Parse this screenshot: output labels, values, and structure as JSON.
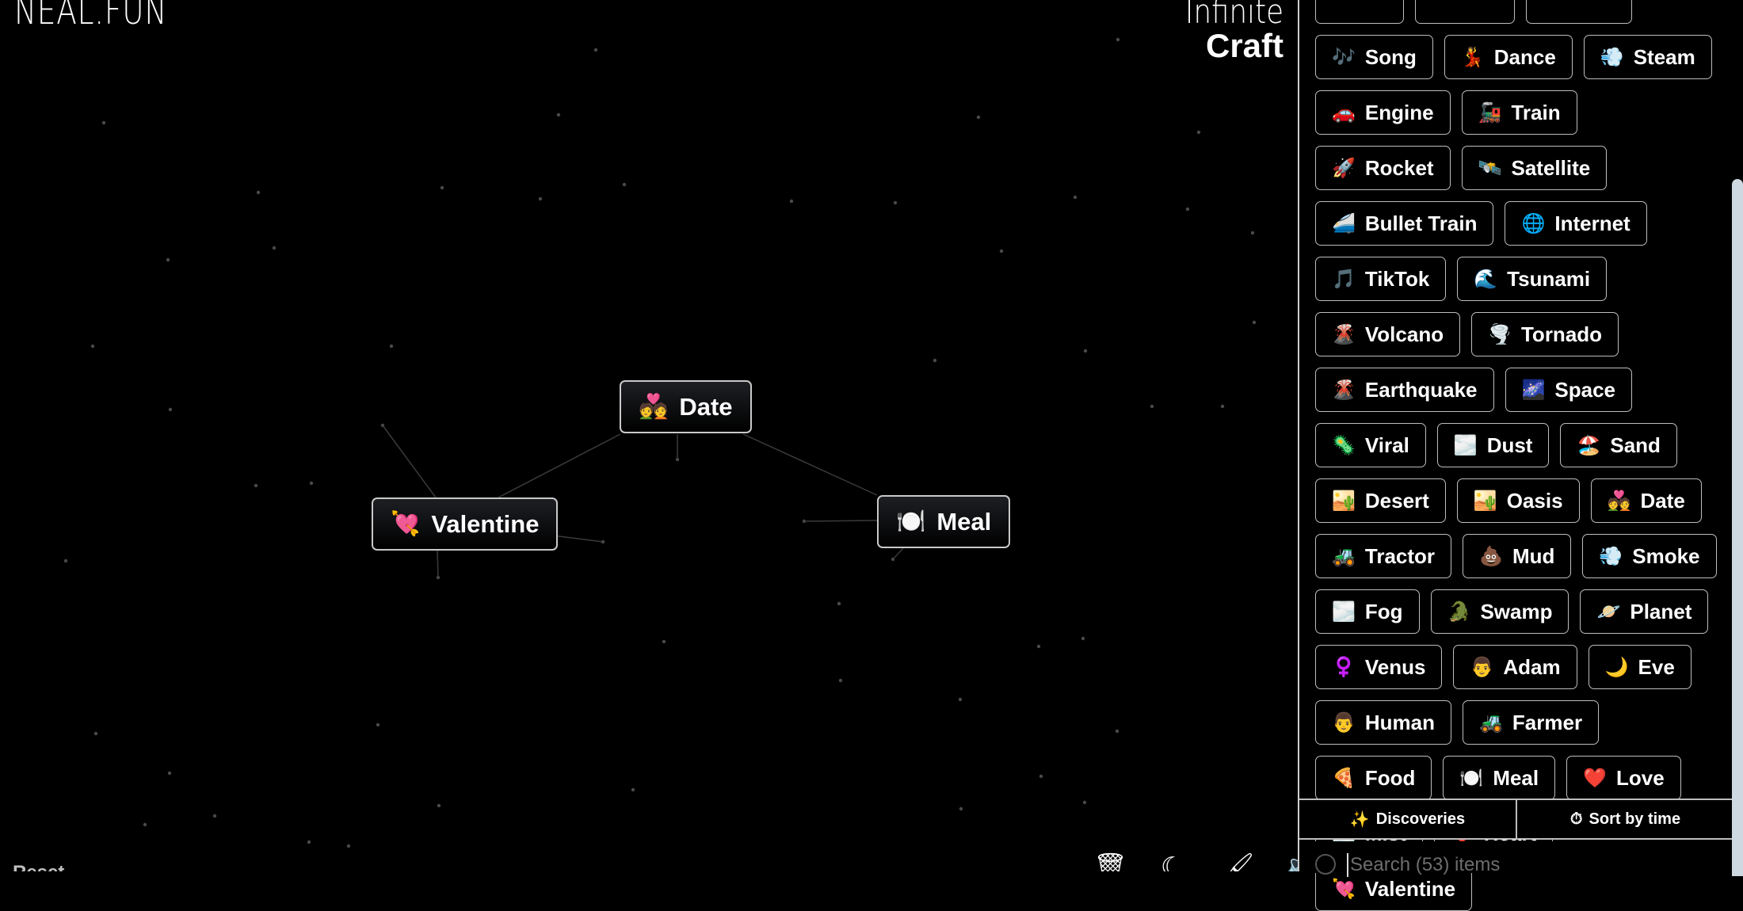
{
  "brand": {
    "left": "NEAL.FUN",
    "right_line1": "Infinite",
    "right_line2": "Craft"
  },
  "canvas": {
    "items": [
      {
        "id": "date",
        "emoji": "💑",
        "label": "Date"
      },
      {
        "id": "valentine",
        "emoji": "💘",
        "label": "Valentine"
      },
      {
        "id": "meal",
        "emoji": "🍽️",
        "label": "Meal"
      }
    ]
  },
  "reset_label": "Reset",
  "toolbar": [
    {
      "name": "trash-icon",
      "glyph": "🗑"
    },
    {
      "name": "dark-mode-icon",
      "glyph": "☾"
    },
    {
      "name": "brush-icon",
      "glyph": "🖌"
    },
    {
      "name": "sound-icon",
      "glyph": "🔈"
    }
  ],
  "sidebar": {
    "items": [
      {
        "emoji": "",
        "label": "        "
      },
      {
        "emoji": "",
        "label": "          "
      },
      {
        "emoji": "",
        "label": "           "
      },
      {
        "emoji": "🎶",
        "label": "Song"
      },
      {
        "emoji": "💃",
        "label": "Dance"
      },
      {
        "emoji": "💨",
        "label": "Steam"
      },
      {
        "emoji": "🚗",
        "label": "Engine"
      },
      {
        "emoji": "🚂",
        "label": "Train"
      },
      {
        "emoji": "🚀",
        "label": "Rocket"
      },
      {
        "emoji": "🛰️",
        "label": "Satellite"
      },
      {
        "emoji": "🚄",
        "label": "Bullet Train"
      },
      {
        "emoji": "🌐",
        "label": "Internet"
      },
      {
        "emoji": "🎵",
        "label": "TikTok"
      },
      {
        "emoji": "🌊",
        "label": "Tsunami"
      },
      {
        "emoji": "🌋",
        "label": "Volcano"
      },
      {
        "emoji": "🌪️",
        "label": "Tornado"
      },
      {
        "emoji": "🌋",
        "label": "Earthquake"
      },
      {
        "emoji": "🌌",
        "label": "Space"
      },
      {
        "emoji": "🦠",
        "label": "Viral"
      },
      {
        "emoji": "🌫️",
        "label": "Dust"
      },
      {
        "emoji": "🏖️",
        "label": "Sand"
      },
      {
        "emoji": "🏜️",
        "label": "Desert"
      },
      {
        "emoji": "🏜️",
        "label": "Oasis"
      },
      {
        "emoji": "💑",
        "label": "Date"
      },
      {
        "emoji": "🚜",
        "label": "Tractor"
      },
      {
        "emoji": "💩",
        "label": "Mud"
      },
      {
        "emoji": "💨",
        "label": "Smoke"
      },
      {
        "emoji": "🌫️",
        "label": "Fog"
      },
      {
        "emoji": "🐊",
        "label": "Swamp"
      },
      {
        "emoji": "🪐",
        "label": "Planet"
      },
      {
        "emoji": "♀️",
        "label": "Venus"
      },
      {
        "emoji": "👨",
        "label": "Adam"
      },
      {
        "emoji": "🌙",
        "label": "Eve"
      },
      {
        "emoji": "👨",
        "label": "Human"
      },
      {
        "emoji": "🚜",
        "label": "Farmer"
      },
      {
        "emoji": "🍕",
        "label": "Food"
      },
      {
        "emoji": "🍽️",
        "label": "Meal"
      },
      {
        "emoji": "❤️",
        "label": "Love"
      },
      {
        "emoji": "🌫️",
        "label": "Mist"
      },
      {
        "emoji": "❤️",
        "label": "Heart"
      },
      {
        "emoji": "💘",
        "label": "Valentine"
      }
    ],
    "footer": {
      "discoveries": {
        "icon": "✨",
        "label": "Discoveries"
      },
      "sort": {
        "icon": "⏱",
        "label": "Sort by time"
      }
    },
    "search": {
      "placeholder": "Search (53) items",
      "value": ""
    }
  }
}
